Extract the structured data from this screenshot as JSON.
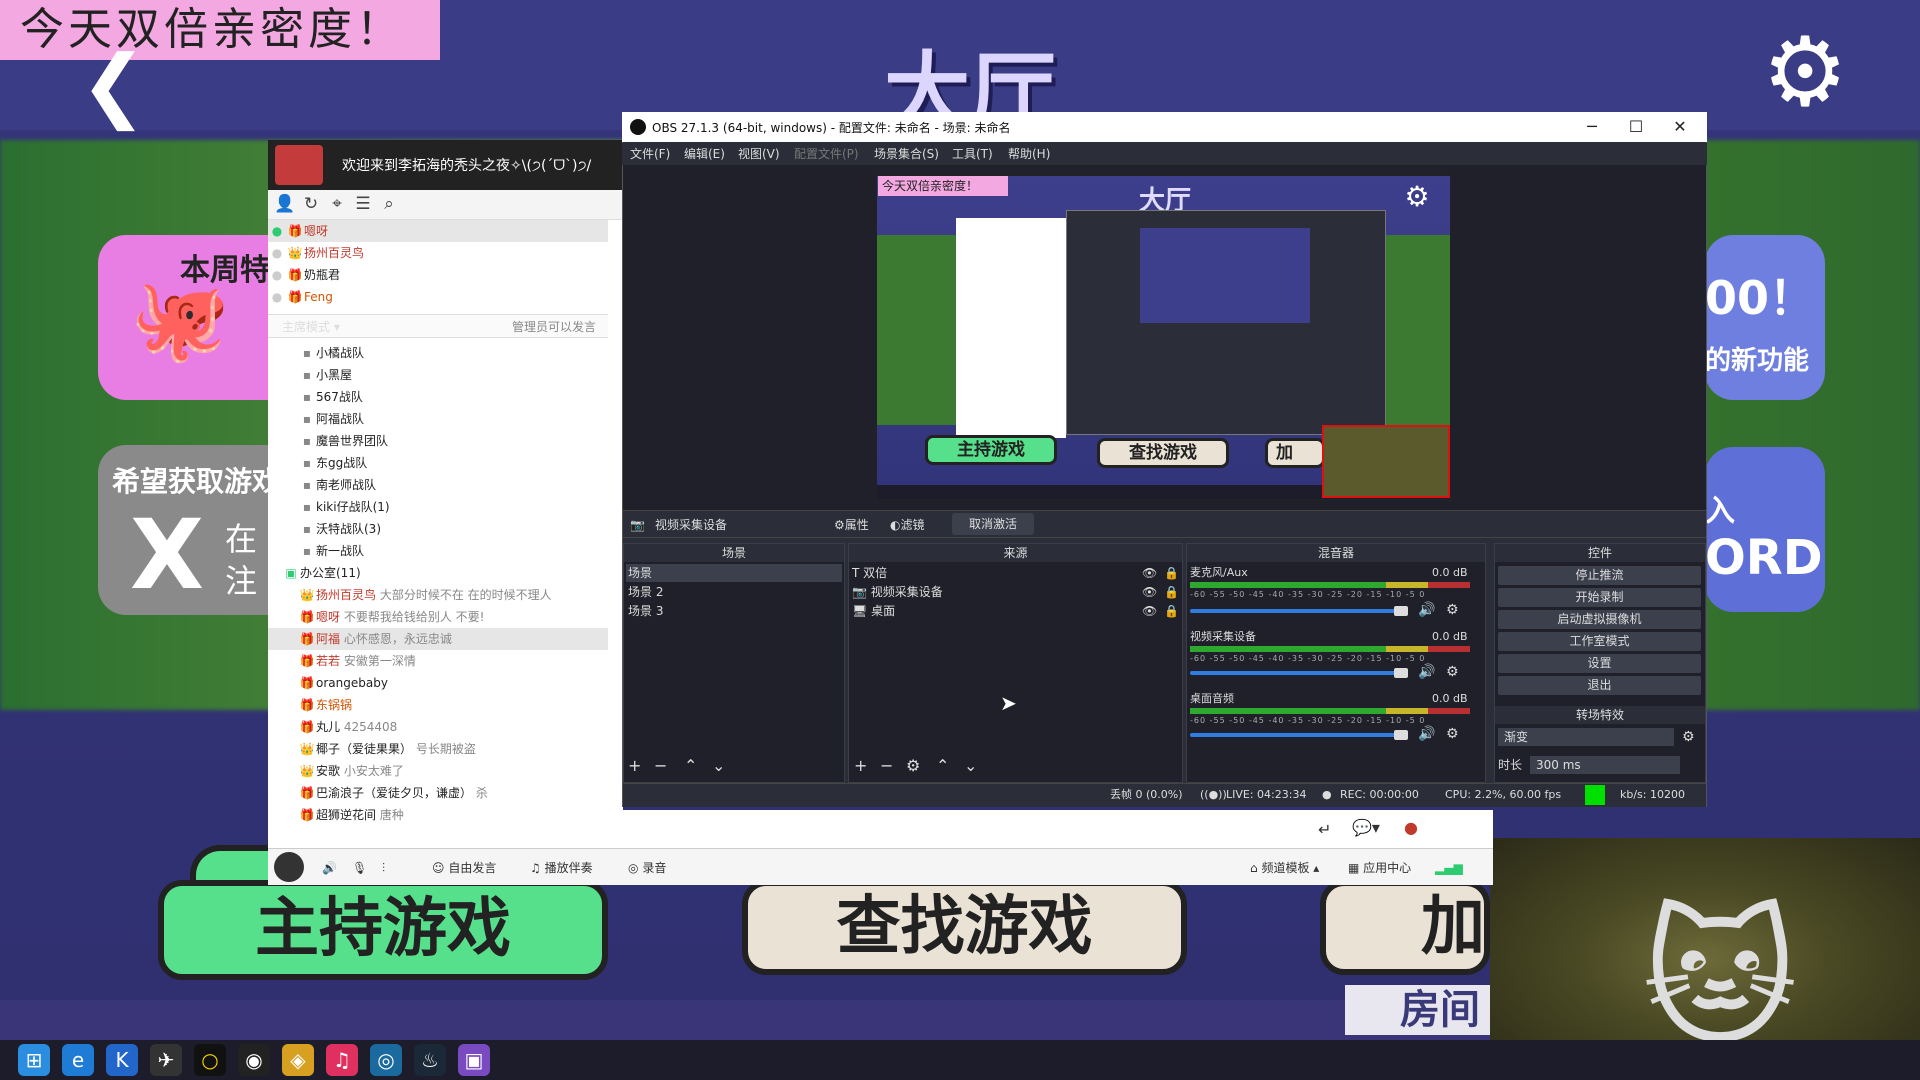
{
  "game": {
    "stream_note": "今天双倍亲密度！",
    "back_arrow": "❮",
    "lobby_title": "大厅",
    "settings_gear": "⚙",
    "weekly_card_label": "本周特",
    "octopus": "🐙",
    "x_card_title": "希望获取游戏",
    "x_logo": "X",
    "x_card_text": "在注",
    "right_card_1_title": "00！",
    "right_card_1_text": "的新功能",
    "right_card_2_title": "入",
    "right_card_2_text": "ORD",
    "host_game": "主持游戏",
    "find_game": "查找游戏",
    "join_game": "加",
    "room": "房间"
  },
  "chat": {
    "title": "欢迎来到李拓海的秃头之夜✧\\(੭(ˊᗜˋ)੭/",
    "mode_label": "主席模式 ▾",
    "admin_only": "管理员可以发言",
    "top_users": [
      "嗯呀",
      "扬州百灵鸟",
      "奶瓶君",
      "Feng"
    ],
    "channels": [
      "小橘战队",
      "小黑屋",
      "567战队",
      "阿福战队",
      "魔兽世界团队",
      "东gg战队",
      "南老师战队",
      "kiki仔战队(1)",
      "沃特战队(3)",
      "新一战队"
    ],
    "office": "办公室(11)",
    "members": [
      {
        "name": "扬州百灵鸟",
        "note": "大部分时候不在 在的时候不理人"
      },
      {
        "name": "嗯呀",
        "note": "不要帮我给钱给别人 不要!"
      },
      {
        "name": "阿福",
        "note": "心怀感恩，永远忠诚"
      },
      {
        "name": "若若",
        "note": "安徽第一深情"
      },
      {
        "name": "orangebaby",
        "note": ""
      },
      {
        "name": "东锅锅",
        "note": ""
      },
      {
        "name": "丸儿",
        "note": "4254408"
      },
      {
        "name": "椰子（爱徒果果）",
        "note": "号长期被盗"
      },
      {
        "name": "安歌",
        "note": "小安太难了"
      },
      {
        "name": "巴渝浪子（爱徒夕贝，谦虚）",
        "note": "杀"
      },
      {
        "name": "超狮逆花间",
        "note": "唐种"
      }
    ],
    "bottom_bar": {
      "free_speech": "自由发言",
      "play_music": "播放伴奏",
      "record": "录音",
      "channel_template": "频道模板",
      "app_center": "应用中心"
    }
  },
  "obs": {
    "title": "OBS 27.1.3 (64-bit, windows) - 配置文件: 未命名 - 场景: 未命名",
    "menus": [
      "文件(F)",
      "编辑(E)",
      "视图(V)",
      "配置文件(P)",
      "场景集合(S)",
      "工具(T)",
      "帮助(H)"
    ],
    "preview": {
      "note": "今天双倍亲密度！",
      "title": "大厅",
      "host": "主持游戏",
      "find": "查找游戏",
      "join": "加"
    },
    "source_bar": {
      "selected_source": "视频采集设备",
      "properties": "属性",
      "filters": "滤镜",
      "deactivate": "取消激活"
    },
    "scenes": {
      "title": "场景",
      "items": [
        "场景",
        "场景 2",
        "场景 3"
      ]
    },
    "sources": {
      "title": "来源",
      "items": [
        "双倍",
        "视频采集设备",
        "桌面"
      ]
    },
    "mixer": {
      "title": "混音器",
      "channels": [
        {
          "name": "麦克风/Aux",
          "db": "0.0 dB"
        },
        {
          "name": "视频采集设备",
          "db": "0.0 dB"
        },
        {
          "name": "桌面音频",
          "db": "0.0 dB"
        }
      ],
      "scale": "-60 -55 -50 -45 -40 -35 -30 -25 -20 -15 -10 -5 0"
    },
    "controls": {
      "title": "控件",
      "buttons": [
        "停止推流",
        "开始录制",
        "启动虚拟摄像机",
        "工作室模式",
        "设置",
        "退出"
      ]
    },
    "transitions": {
      "title": "转场特效",
      "type": "渐变",
      "duration_label": "时长",
      "duration": "300 ms"
    },
    "status": {
      "dropped": "丢帧 0 (0.0%)",
      "live": "LIVE: 04:23:34",
      "rec": "REC: 00:00:00",
      "cpu": "CPU: 2.2%, 60.00 fps",
      "kbps": "kb/s: 10200"
    }
  }
}
